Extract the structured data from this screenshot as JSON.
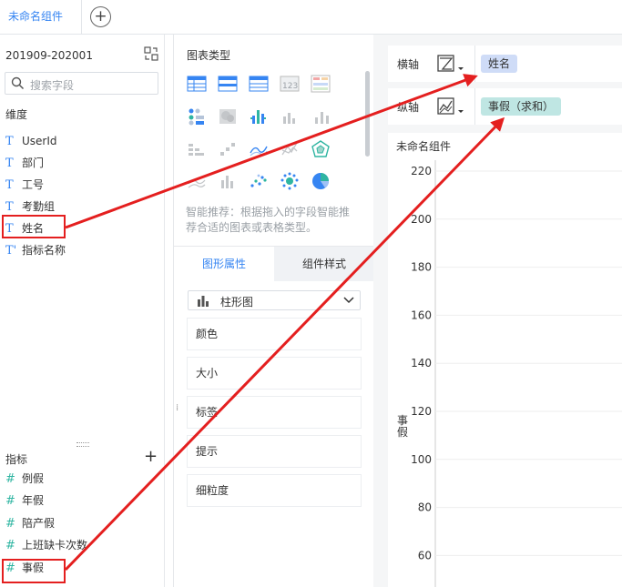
{
  "tabs": {
    "active_label": "未命名组件",
    "add_icon": "plus-circle-icon"
  },
  "left": {
    "dataset_name": "201909-202001",
    "search_placeholder": "搜索字段",
    "dimensions_title": "维度",
    "dimensions": [
      {
        "type": "T",
        "label": "UserId"
      },
      {
        "type": "T",
        "label": "部门"
      },
      {
        "type": "T",
        "label": "工号"
      },
      {
        "type": "T",
        "label": "考勤组"
      },
      {
        "type": "T",
        "label": "姓名"
      },
      {
        "type": "T'",
        "label": "指标名称"
      }
    ],
    "metrics_title": "指标",
    "metrics": [
      {
        "type": "#",
        "label": "例假"
      },
      {
        "type": "#",
        "label": "年假"
      },
      {
        "type": "#",
        "label": "陪产假"
      },
      {
        "type": "#",
        "label": "上班缺卡次数"
      },
      {
        "type": "#",
        "label": "事假"
      }
    ]
  },
  "chart_types": {
    "title": "图表类型",
    "recommendation": "智能推荐：根据拖入的字段智能推荐合适的图表或表格类型。",
    "tabs": [
      "图形属性",
      "组件样式"
    ],
    "selected_type": "柱形图",
    "properties": [
      "颜色",
      "大小",
      "标签",
      "提示",
      "细粒度"
    ]
  },
  "axes": {
    "x_label": "横轴",
    "x_field": "姓名",
    "y_label": "纵轴",
    "y_field": "事假（求和）"
  },
  "colors": {
    "accent": "#3685f2",
    "dim_pill": "#cfdcf7",
    "metric_pill": "#bfe6e3",
    "annotation": "#e41f1f"
  },
  "chart_data": {
    "type": "bar",
    "title": "未命名组件",
    "ylabel": "事假",
    "yticks": [
      60,
      80,
      100,
      120,
      140,
      160,
      180,
      200,
      220
    ],
    "ylim": [
      50,
      222
    ],
    "categories": [],
    "values": [],
    "grid": true
  }
}
